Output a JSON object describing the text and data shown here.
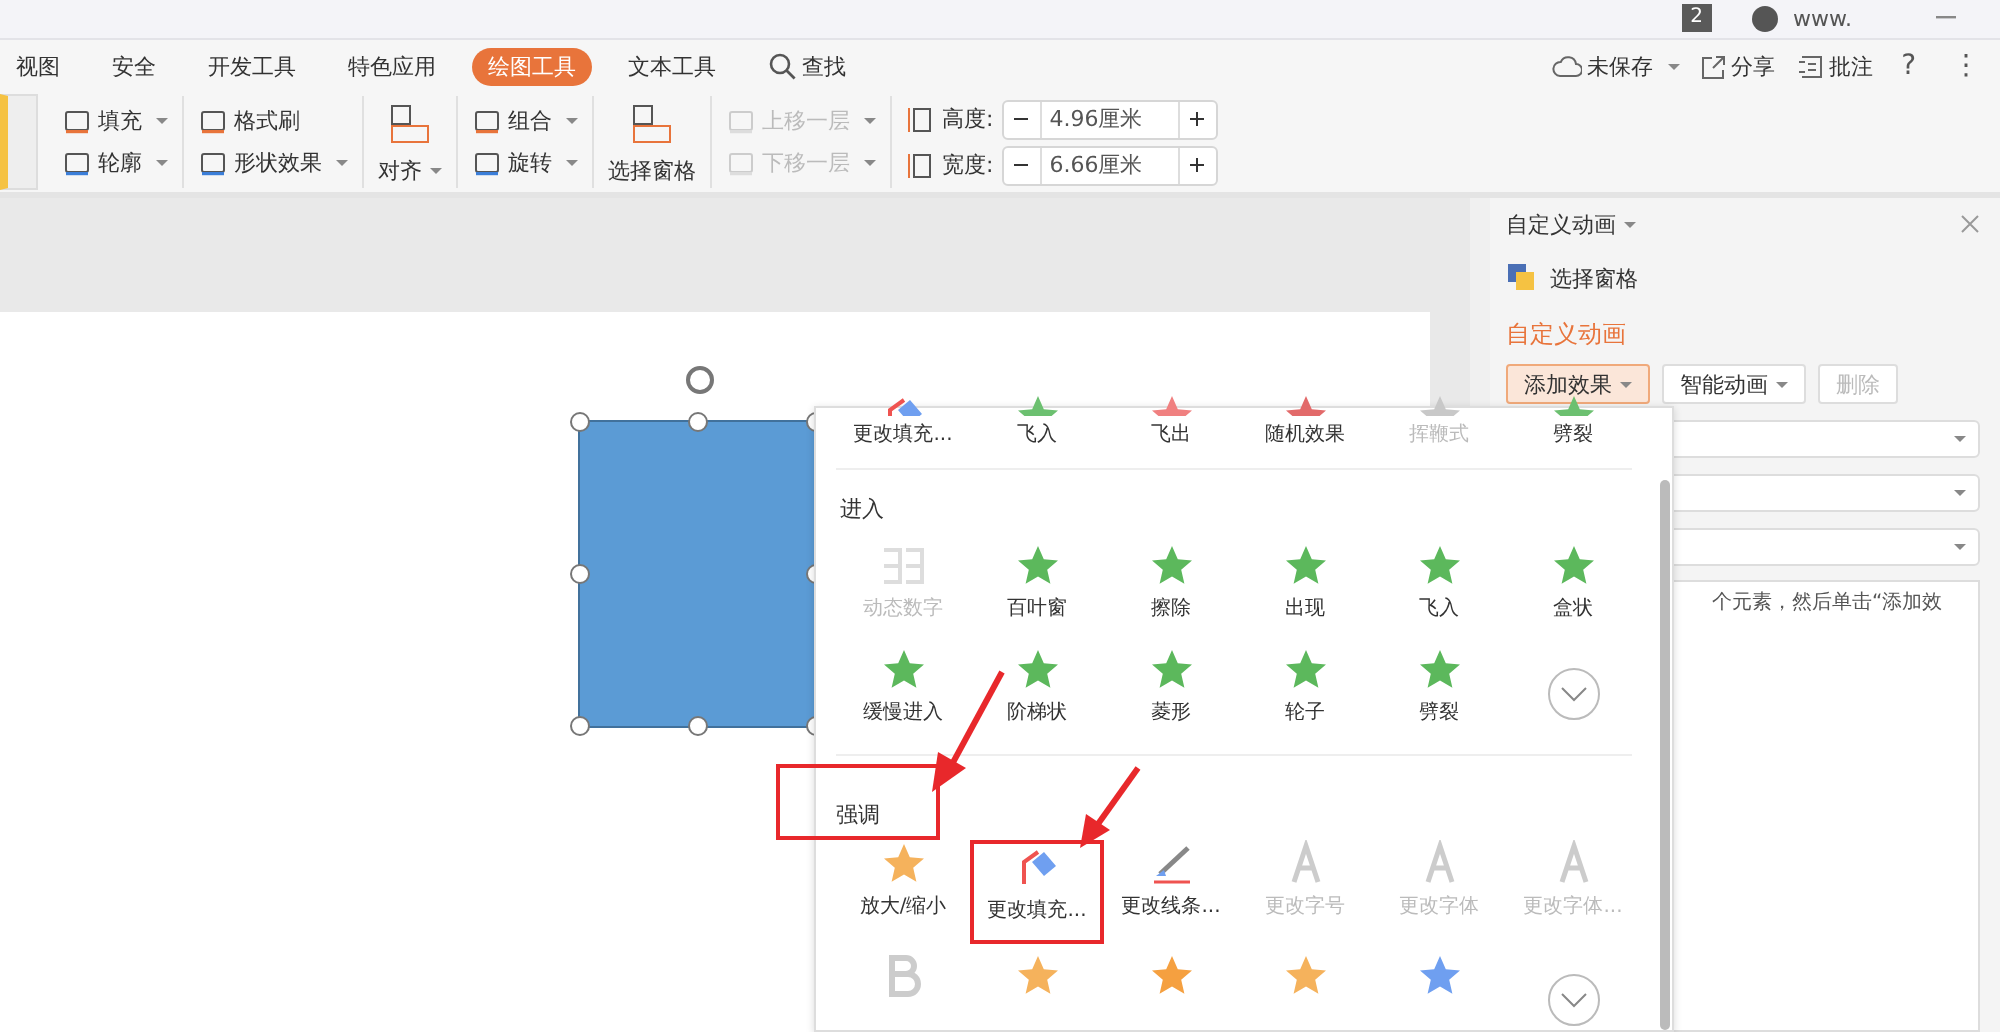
{
  "title_bar": {
    "badge": "2",
    "user": "www."
  },
  "tabs": [
    {
      "label": "视图",
      "selected": false
    },
    {
      "label": "安全",
      "selected": false
    },
    {
      "label": "开发工具",
      "selected": false
    },
    {
      "label": "特色应用",
      "selected": false
    },
    {
      "label": "绘图工具",
      "selected": true
    },
    {
      "label": "文本工具",
      "selected": false
    },
    {
      "label": "查找",
      "selected": false,
      "kind": "search"
    }
  ],
  "actions": [
    {
      "label": "未保存",
      "dropdown": true,
      "kind": "cloud"
    },
    {
      "label": "分享",
      "dropdown": false,
      "kind": "share"
    },
    {
      "label": "批注",
      "dropdown": false,
      "kind": "comment"
    },
    {
      "label": "?",
      "dropdown": false,
      "kind": "text"
    },
    {
      "label": "⋮",
      "dropdown": false,
      "kind": "text"
    }
  ],
  "ribbon": {
    "groups": [
      {
        "kind": "stack",
        "items": [
          {
            "label": "填充",
            "dropdown": true,
            "disabled": false
          },
          {
            "label": "轮廓",
            "dropdown": true,
            "disabled": false
          }
        ]
      },
      {
        "kind": "stack",
        "items": [
          {
            "label": "格式刷",
            "dropdown": false,
            "disabled": false
          },
          {
            "label": "形状效果",
            "dropdown": true,
            "disabled": false
          }
        ]
      },
      {
        "kind": "large",
        "items": [
          {
            "label": "对齐",
            "dropdown": true,
            "disabled": false
          }
        ]
      },
      {
        "kind": "stack",
        "items": [
          {
            "label": "组合",
            "dropdown": true,
            "disabled": false
          },
          {
            "label": "旋转",
            "dropdown": true,
            "disabled": false
          }
        ]
      },
      {
        "kind": "large",
        "items": [
          {
            "label": "选择窗格",
            "dropdown": false,
            "disabled": false
          }
        ]
      },
      {
        "kind": "stack",
        "items": [
          {
            "label": "上移一层",
            "dropdown": true,
            "disabled": true
          },
          {
            "label": "下移一层",
            "dropdown": true,
            "disabled": true
          }
        ]
      },
      {
        "kind": "size",
        "items": [
          {
            "label": "高度:",
            "value": "4.96厘米"
          },
          {
            "label": "宽度:",
            "value": "6.66厘米"
          }
        ]
      }
    ]
  },
  "pane": {
    "title": "自定义动画",
    "select_pane": "选择窗格",
    "heading": "自定义动画",
    "buttons": [
      {
        "label": "添加效果",
        "dropdown": true,
        "selected": true,
        "disabled": false
      },
      {
        "label": "智能动画",
        "dropdown": true,
        "selected": false,
        "disabled": false
      },
      {
        "label": "删除",
        "dropdown": false,
        "selected": false,
        "disabled": true
      }
    ],
    "hint": "个元素，然后单击“添加效"
  },
  "effects_menu": {
    "sections": [
      {
        "items": [
          {
            "label": "更改填充...",
            "kind": "fill",
            "disabled": false,
            "marked": false
          },
          {
            "label": "飞入",
            "kind": "star",
            "color": "#6cc070",
            "disabled": false,
            "marked": false
          },
          {
            "label": "飞出",
            "kind": "star",
            "color": "#f08080",
            "disabled": false,
            "marked": false
          },
          {
            "label": "随机效果",
            "kind": "star",
            "color": "#e26a6a",
            "disabled": false,
            "marked": false
          },
          {
            "label": "挥鞭式",
            "kind": "star",
            "color": "#c8c8c8",
            "disabled": true,
            "marked": false
          },
          {
            "label": "劈裂",
            "kind": "star",
            "color": "#6cc070",
            "disabled": false,
            "marked": false
          }
        ]
      },
      {
        "title": "进入",
        "marked": false,
        "more": true,
        "items": [
          {
            "label": "动态数字",
            "kind": "digits",
            "disabled": true,
            "marked": false
          },
          {
            "label": "百叶窗",
            "kind": "star",
            "color": "#5cb85c",
            "disabled": false,
            "marked": false
          },
          {
            "label": "擦除",
            "kind": "star",
            "color": "#5cb85c",
            "disabled": false,
            "marked": false
          },
          {
            "label": "出现",
            "kind": "star",
            "color": "#5cb85c",
            "disabled": false,
            "marked": false
          },
          {
            "label": "飞入",
            "kind": "star",
            "color": "#5cb85c",
            "disabled": false,
            "marked": false
          },
          {
            "label": "盒状",
            "kind": "star",
            "color": "#5cb85c",
            "disabled": false,
            "marked": false
          },
          {
            "label": "缓慢进入",
            "kind": "star",
            "color": "#5cb85c",
            "disabled": false,
            "marked": false
          },
          {
            "label": "阶梯状",
            "kind": "star",
            "color": "#5cb85c",
            "disabled": false,
            "marked": false
          },
          {
            "label": "菱形",
            "kind": "star",
            "color": "#5cb85c",
            "disabled": false,
            "marked": false
          },
          {
            "label": "轮子",
            "kind": "star",
            "color": "#5cb85c",
            "disabled": false,
            "marked": false
          },
          {
            "label": "劈裂",
            "kind": "star",
            "color": "#5cb85c",
            "disabled": false,
            "marked": false
          }
        ]
      },
      {
        "title": "强调",
        "marked": true,
        "more": true,
        "items": [
          {
            "label": "放大/缩小",
            "kind": "star",
            "color": "#f5b25c",
            "disabled": false,
            "marked": false
          },
          {
            "label": "更改填充...",
            "kind": "fill",
            "disabled": false,
            "marked": true
          },
          {
            "label": "更改线条...",
            "kind": "line",
            "disabled": false,
            "marked": false
          },
          {
            "label": "更改字号",
            "kind": "letter",
            "disabled": true,
            "marked": false
          },
          {
            "label": "更改字体",
            "kind": "letter",
            "disabled": true,
            "marked": false
          },
          {
            "label": "更改字体...",
            "kind": "letter",
            "disabled": true,
            "marked": false
          },
          {
            "kind": "bold",
            "disabled": true,
            "marked": false
          },
          {
            "kind": "star",
            "color": "#f5b25c",
            "disabled": false,
            "marked": false
          },
          {
            "kind": "star",
            "color": "#f5a040",
            "disabled": false,
            "marked": false
          },
          {
            "kind": "star",
            "color": "#f5b25c",
            "disabled": false,
            "marked": false
          },
          {
            "kind": "star",
            "color": "#6f9ff0",
            "disabled": false,
            "marked": false
          }
        ]
      }
    ]
  }
}
